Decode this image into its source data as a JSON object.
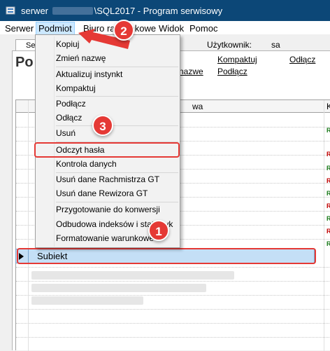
{
  "window": {
    "title_prefix": "serwer",
    "title_suffix": "\\SQL2017 - Program serwisowy"
  },
  "menubar": {
    "items": [
      "Serwer",
      "Podmiot",
      "Biuro rachunkowe",
      "Widok",
      "Pomoc"
    ]
  },
  "toolbar": {
    "tab_label": "Se",
    "user_label": "Użytkownik:",
    "user_value": "sa"
  },
  "panel": {
    "title_partial": "Po",
    "links": {
      "kompaktuj": "Kompaktuj",
      "odlacz": "Odłącz",
      "podlacz": "Podłącz",
      "nazwe": "nazwe"
    }
  },
  "grid": {
    "header_partial": "wa",
    "header_col2": "K",
    "tags": [
      "R",
      "R",
      "Ra",
      "R",
      "R",
      "R",
      "R",
      "R",
      "Ra"
    ],
    "selected_row_label": "Subiekt"
  },
  "dropdown": {
    "items": [
      "Kopiuj",
      "Zmień nazwę",
      "Aktualizuj instynkt",
      "Kompaktuj",
      "Podłącz",
      "Odłącz",
      "Usuń",
      "Odczyt hasła",
      "Kontrola danych",
      "Usuń dane Rachmistrza GT",
      "Usuń dane Rewizora GT",
      "Przygotowanie do konwersji",
      "Odbudowa indeksów i statystyk",
      "Formatowanie warunkowe"
    ]
  },
  "annotations": {
    "badges": [
      "1",
      "2",
      "3"
    ]
  },
  "colors": {
    "titlebar": "#0c4777",
    "annotation_red": "#e53935",
    "selection": "#c4dff6",
    "tag_green": "#1a7a1a",
    "tag_red": "#c00000"
  }
}
